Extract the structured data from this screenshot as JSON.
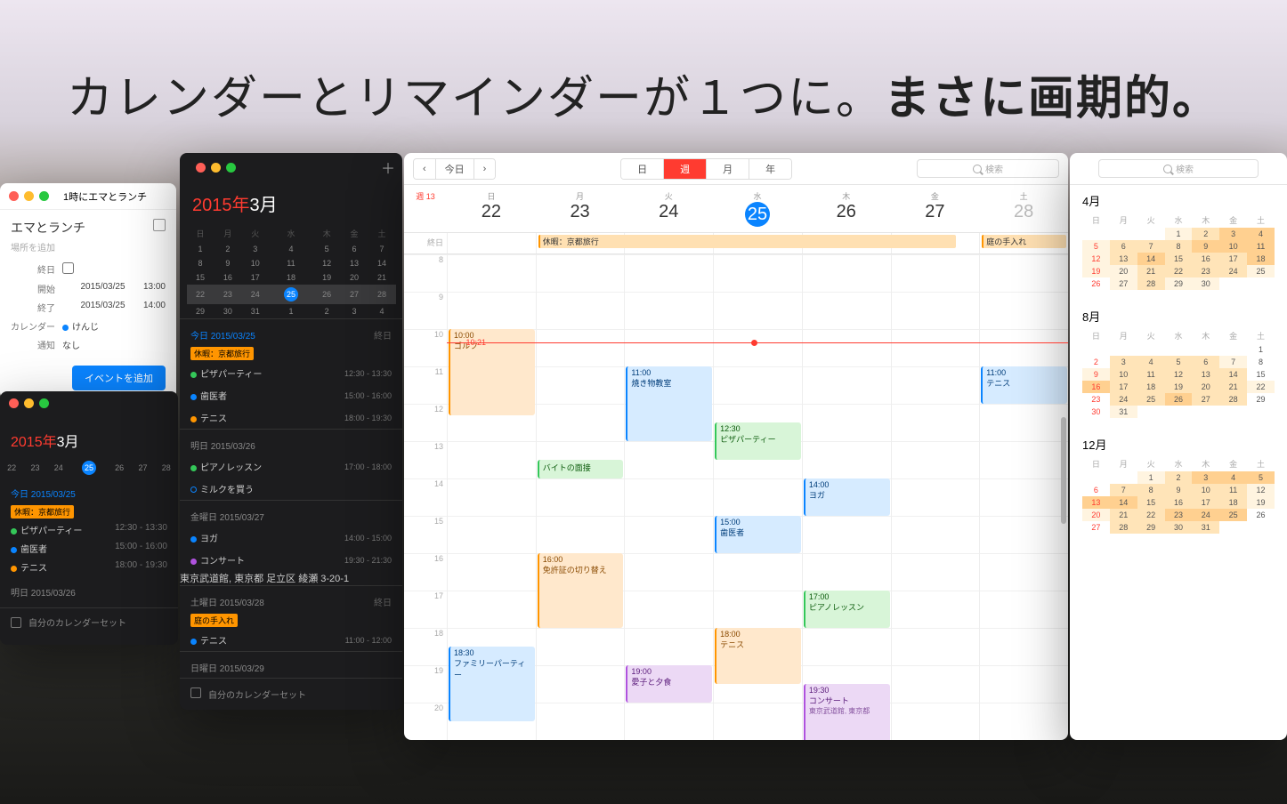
{
  "tagline": {
    "part1": "カレンダーとリマインダーが１つに。",
    "part2": "まさに画期的。"
  },
  "editor": {
    "quick_entry": "1時にエマとランチ",
    "title": "エマとランチ",
    "location_placeholder": "場所を追加",
    "allday_label": "終日",
    "start_label": "開始",
    "start_date": "2015/03/25",
    "start_time": "13:00",
    "end_label": "終了",
    "end_date": "2015/03/25",
    "end_time": "14:00",
    "calendar_label": "カレンダー",
    "calendar_value": "けんじ",
    "alert_label": "通知",
    "alert_value": "なし",
    "submit": "イベントを追加"
  },
  "mini2": {
    "year": "2015年",
    "month": "3月",
    "today_hdr": "今日 2015/03/25",
    "allday_pill": "休暇：京都旅行",
    "events": [
      {
        "color": "#34c759",
        "title": "ピザパーティー",
        "time": "12:30 - 13:30"
      },
      {
        "color": "#0a84ff",
        "title": "歯医者",
        "time": "15:00 - 16:00"
      },
      {
        "color": "#ff9500",
        "title": "テニス",
        "time": "18:00 - 19:30"
      }
    ],
    "tomorrow_hdr": "明日 2015/03/26",
    "footer": "自分のカレンダーセット"
  },
  "sidebar": {
    "year": "2015年",
    "month": "3月",
    "dow": [
      "日",
      "月",
      "火",
      "水",
      "木",
      "金",
      "土"
    ],
    "weeks": [
      [
        "1",
        "2",
        "3",
        "4",
        "5",
        "6",
        "7"
      ],
      [
        "8",
        "9",
        "10",
        "11",
        "12",
        "13",
        "14"
      ],
      [
        "15",
        "16",
        "17",
        "18",
        "19",
        "20",
        "21"
      ],
      [
        "22",
        "23",
        "24",
        "25",
        "26",
        "27",
        "28"
      ],
      [
        "29",
        "30",
        "31",
        "1",
        "2",
        "3",
        "4"
      ]
    ],
    "today_day": "25",
    "sections": [
      {
        "hdr": "今日 2015/03/25",
        "today": true,
        "right": "終日",
        "pill": "休暇：京都旅行",
        "events": [
          {
            "dot": "#34c759",
            "title": "ピザパーティー",
            "time": "12:30 - 13:30"
          },
          {
            "dot": "#0a84ff",
            "title": "歯医者",
            "time": "15:00 - 16:00"
          },
          {
            "dot": "#ff9500",
            "title": "テニス",
            "time": "18:00 - 19:30"
          }
        ]
      },
      {
        "hdr": "明日 2015/03/26",
        "events": [
          {
            "dot": "#34c759",
            "title": "ピアノレッスン",
            "time": "17:00 - 18:00"
          },
          {
            "open": true,
            "title": "ミルクを買う",
            "time": ""
          }
        ]
      },
      {
        "hdr": "金曜日 2015/03/27",
        "events": [
          {
            "dot": "#0a84ff",
            "title": "ヨガ",
            "time": "14:00 - 15:00"
          },
          {
            "dot": "#af52de",
            "title": "コンサート",
            "time": "19:30 - 21:30",
            "loc": "東京武道館, 東京都 足立区 綾瀬 3-20-1"
          }
        ]
      },
      {
        "hdr": "土曜日 2015/03/28",
        "right": "終日",
        "pill": "庭の手入れ",
        "pill_color": "#ff9500",
        "events": [
          {
            "dot": "#0a84ff",
            "title": "テニス",
            "time": "11:00 - 12:00"
          }
        ]
      },
      {
        "hdr": "日曜日 2015/03/29",
        "events": []
      }
    ],
    "footer": "自分のカレンダーセット"
  },
  "week": {
    "today_btn": "今日",
    "views": [
      "日",
      "週",
      "月",
      "年"
    ],
    "active_view": "週",
    "search_placeholder": "検索",
    "week_num": "週 13",
    "days": [
      {
        "dow": "日",
        "num": "22"
      },
      {
        "dow": "月",
        "num": "23"
      },
      {
        "dow": "火",
        "num": "24"
      },
      {
        "dow": "水",
        "num": "25",
        "today": true
      },
      {
        "dow": "木",
        "num": "26"
      },
      {
        "dow": "金",
        "num": "27"
      },
      {
        "dow": "土",
        "num": "28",
        "sat": true
      }
    ],
    "allday_label": "終日",
    "allday": {
      "1": [
        "休暇：京都旅行"
      ],
      "6": [
        "庭の手入れ"
      ]
    },
    "allday_span": {
      "start": 1,
      "end": 5,
      "text": "休暇：京都旅行"
    },
    "hours": [
      "8",
      "9",
      "10",
      "11",
      "12",
      "13",
      "14",
      "15",
      "16",
      "17",
      "18",
      "19",
      "20"
    ],
    "now": "10:21",
    "events": [
      {
        "day": 0,
        "start": 10,
        "end": 12.3,
        "cls": "c-orange",
        "time": "10:00",
        "title": "ゴルフ"
      },
      {
        "day": 2,
        "start": 11,
        "end": 13,
        "cls": "c-blue",
        "time": "11:00",
        "title": "焼き物教室"
      },
      {
        "day": 1,
        "start": 13.5,
        "end": 14,
        "cls": "c-green",
        "time": "",
        "title": "バイトの面接"
      },
      {
        "day": 3,
        "start": 12.5,
        "end": 13.5,
        "cls": "c-green",
        "time": "12:30",
        "title": "ピザパーティー"
      },
      {
        "day": 3,
        "start": 15,
        "end": 16,
        "cls": "c-blue",
        "time": "15:00",
        "title": "歯医者"
      },
      {
        "day": 1,
        "start": 16,
        "end": 18,
        "cls": "c-orange",
        "time": "16:00",
        "title": "免許証の切り替え"
      },
      {
        "day": 4,
        "start": 14,
        "end": 15,
        "cls": "c-blue",
        "time": "14:00",
        "title": "ヨガ"
      },
      {
        "day": 4,
        "start": 17,
        "end": 18,
        "cls": "c-green",
        "time": "17:00",
        "title": "ピアノレッスン"
      },
      {
        "day": 3,
        "start": 18,
        "end": 19.5,
        "cls": "c-orange",
        "time": "18:00",
        "title": "テニス"
      },
      {
        "day": 0,
        "start": 18.5,
        "end": 20.5,
        "cls": "c-blue",
        "time": "18:30",
        "title": "ファミリーパーティー"
      },
      {
        "day": 2,
        "start": 19,
        "end": 20,
        "cls": "c-purple",
        "time": "19:00",
        "title": "愛子と夕食"
      },
      {
        "day": 4,
        "start": 19.5,
        "end": 21.5,
        "cls": "c-purple",
        "time": "19:30",
        "title": "コンサート",
        "loc": "東京武道館, 東京都"
      },
      {
        "day": 6,
        "start": 11,
        "end": 12,
        "cls": "c-blue",
        "time": "11:00",
        "title": "テニス"
      }
    ]
  },
  "year": {
    "search_placeholder": "検索",
    "months": [
      {
        "name": "4月",
        "first_dow": 3,
        "days": 30,
        "heat": {
          "1": 1,
          "2": 2,
          "3": 3,
          "4": 3,
          "5": 1,
          "6": 2,
          "7": 2,
          "8": 2,
          "9": 3,
          "10": 3,
          "11": 3,
          "12": 1,
          "13": 2,
          "14": 3,
          "15": 2,
          "16": 2,
          "17": 2,
          "18": 3,
          "19": 1,
          "20": 1,
          "21": 2,
          "22": 2,
          "23": 2,
          "24": 2,
          "25": 1,
          "27": 1,
          "28": 2,
          "29": 1,
          "30": 1
        }
      },
      {
        "name": "8月",
        "first_dow": 6,
        "days": 31,
        "heat": {
          "3": 2,
          "4": 2,
          "5": 2,
          "6": 2,
          "7": 1,
          "9": 1,
          "10": 2,
          "11": 2,
          "12": 2,
          "13": 2,
          "14": 2,
          "16": 3,
          "17": 2,
          "18": 2,
          "19": 2,
          "20": 2,
          "21": 2,
          "22": 1,
          "24": 2,
          "25": 2,
          "26": 3,
          "27": 2,
          "28": 2,
          "31": 1
        }
      },
      {
        "name": "12月",
        "first_dow": 2,
        "days": 31,
        "heat": {
          "1": 1,
          "2": 2,
          "3": 3,
          "4": 3,
          "5": 3,
          "7": 2,
          "8": 2,
          "9": 2,
          "10": 2,
          "11": 2,
          "12": 1,
          "13": 3,
          "14": 3,
          "15": 2,
          "16": 2,
          "17": 2,
          "18": 2,
          "19": 1,
          "20": 1,
          "21": 2,
          "22": 2,
          "23": 3,
          "24": 3,
          "25": 3,
          "28": 2,
          "29": 2,
          "30": 2,
          "31": 2
        }
      }
    ],
    "dow": [
      "日",
      "月",
      "火",
      "水",
      "木",
      "金",
      "土"
    ]
  }
}
